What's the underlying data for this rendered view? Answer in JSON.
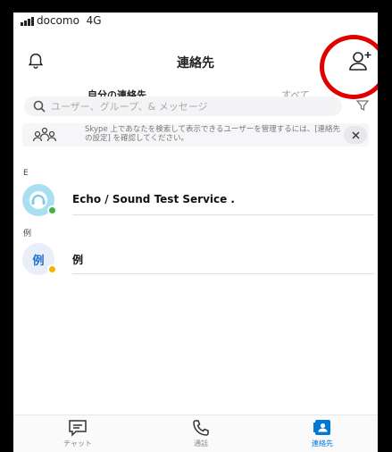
{
  "status": {
    "carrier": "docomo",
    "network": "4G"
  },
  "header": {
    "title": "連絡先",
    "bell_icon": "bell-icon",
    "add_contact_icon": "add-contact-icon"
  },
  "tabs": [
    {
      "label": "自分の連絡先",
      "active": true
    },
    {
      "label": "すべて",
      "active": false
    }
  ],
  "search": {
    "placeholder": "ユーザー、グループ、& メッセージ"
  },
  "info_banner": {
    "text": "Skype 上であなたを検索して表示できるユーザーを管理するには、[連絡先の設定] を確認してください。"
  },
  "sections": [
    {
      "header": "E",
      "contacts": [
        {
          "name": "Echo / Sound Test Service .",
          "presence": "online"
        }
      ]
    },
    {
      "header": "例",
      "contacts": [
        {
          "avatar_text": "例",
          "name": "例",
          "presence": "away"
        }
      ]
    }
  ],
  "bottom_nav": [
    {
      "label": "チャット",
      "icon": "chat-icon",
      "active": false
    },
    {
      "label": "通話",
      "icon": "phone-icon",
      "active": false
    },
    {
      "label": "連絡先",
      "icon": "contacts-icon",
      "active": true
    }
  ],
  "colors": {
    "accent": "#0078d4",
    "online": "#3cb44a",
    "away": "#f4b400",
    "highlight_circle": "#e00000"
  }
}
